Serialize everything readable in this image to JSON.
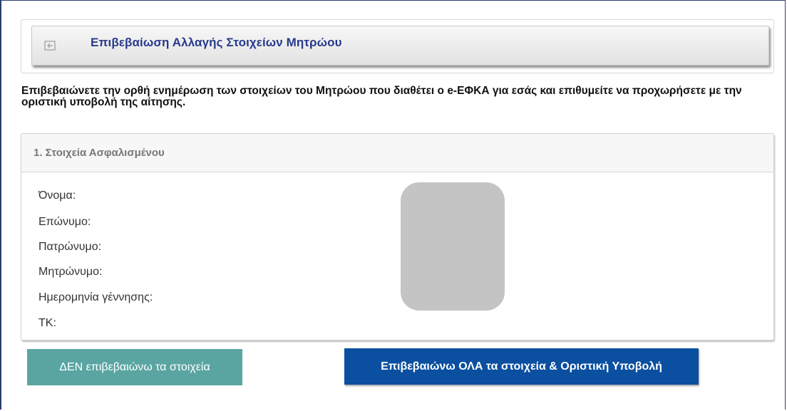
{
  "header": {
    "icon": "exit-arrow-icon",
    "title": "Επιβεβαίωση Αλλαγής Στοιχείων Μητρώου"
  },
  "intro": {
    "before": "Επιβεβαιώνετε την ορθή ενημέρωση των στοιχείων του Μητρώου που διαθέτει ο ",
    "emphasis": "e-ΕΦΚΑ",
    "after": " για εσάς και επιθυμείτε να προχωρήσετε με την οριστική υποβολή της αίτησης."
  },
  "insured": {
    "title": "1. Στοιχεία Ασφαλισμένου",
    "fields": [
      {
        "label": "Όνομα:"
      },
      {
        "label": "Επώνυμο:"
      },
      {
        "label": "Πατρώνυμο:"
      },
      {
        "label": "Μητρώνυμο:"
      },
      {
        "label": "Ημερομηνία γέννησης:"
      },
      {
        "label": "ΤΚ:"
      }
    ]
  },
  "actions": {
    "decline_label": "ΔΕΝ επιβεβαιώνω τα στοιχεία",
    "confirm_label": "Επιβεβαιώνω ΟΛΑ τα στοιχεία & Οριστική Υποβολή"
  },
  "colors": {
    "title_blue": "#283a8c",
    "decline_teal": "#5aa5a2",
    "confirm_blue": "#0b4fa0",
    "photo_placeholder": "#c4c4c4"
  }
}
